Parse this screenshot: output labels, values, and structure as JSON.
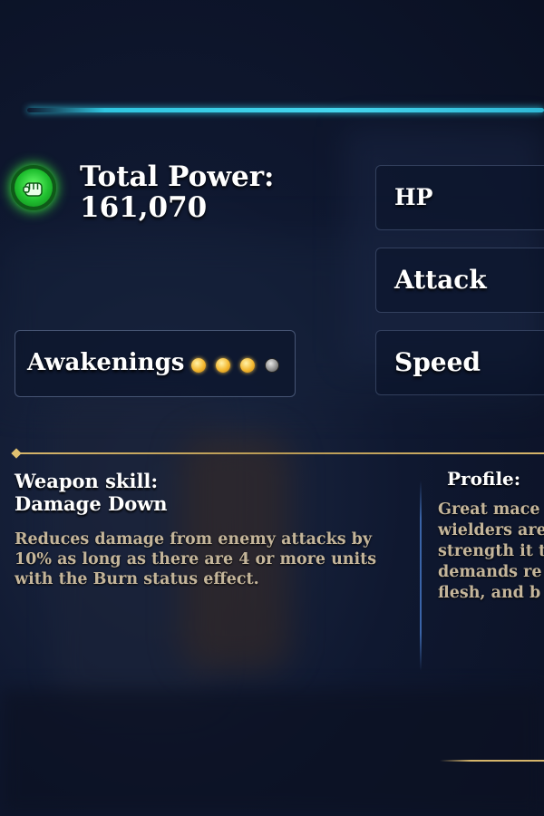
{
  "power": {
    "label": "Total Power:",
    "value": "161,070",
    "icon": "fist-icon",
    "icon_color": "#2ed63a"
  },
  "stats": [
    {
      "label": "HP"
    },
    {
      "label": "Attack"
    },
    {
      "label": "Speed"
    }
  ],
  "awakenings": {
    "label": "Awakenings",
    "filled": 3,
    "total": 4,
    "filled_color": "#f4b830",
    "empty_color": "#8a8a8a"
  },
  "weapon_skill": {
    "title": "Weapon skill:",
    "name": "Damage Down",
    "description": "Reduces damage from enemy attacks by 10% as long as there are 4 or more units with the Burn status effect."
  },
  "profile": {
    "title": "Profile:",
    "lines": [
      "Great mace",
      "wielders are",
      "strength it t",
      "demands re",
      "flesh, and b"
    ]
  },
  "colors": {
    "accent_cyan": "#2fc6e0",
    "accent_gold": "#d6b56a",
    "description_text": "#c4b59a"
  }
}
